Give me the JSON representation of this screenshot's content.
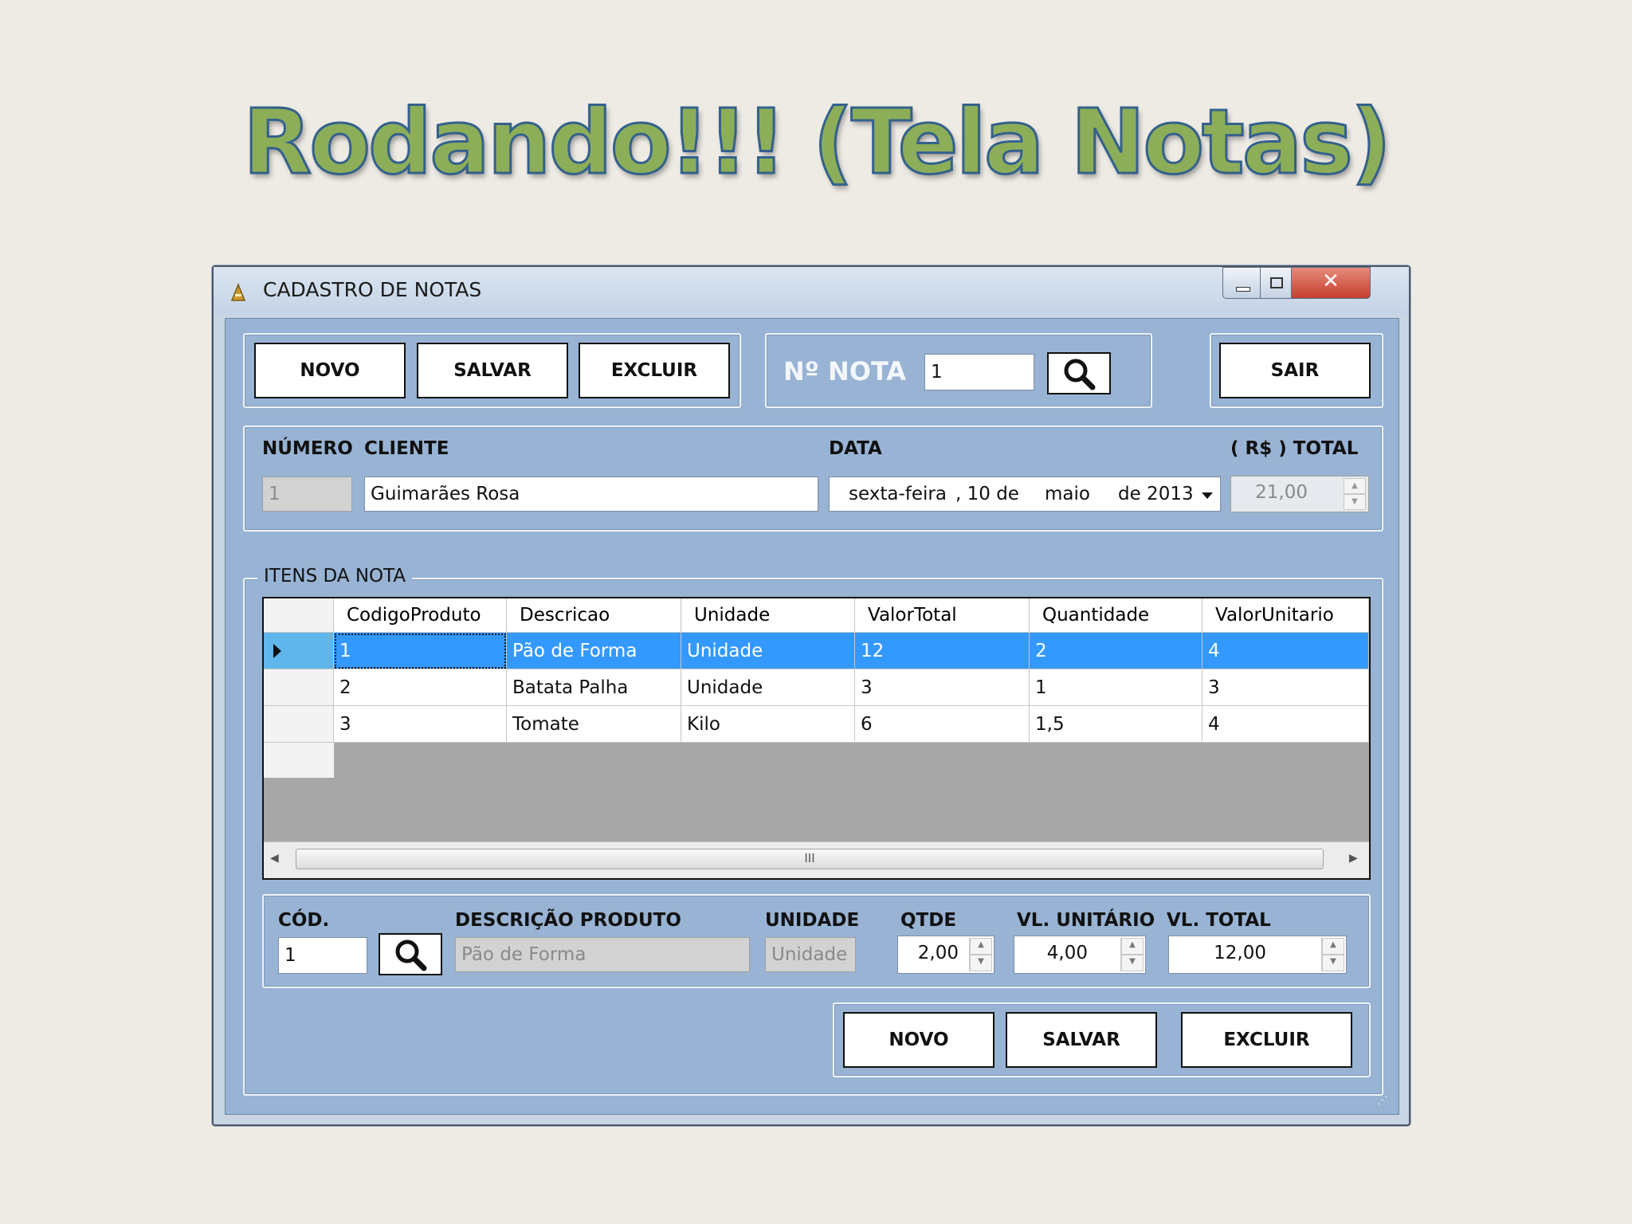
{
  "slide": {
    "title": "Rodando!!! (Tela Notas)"
  },
  "window": {
    "title": "CADASTRO DE NOTAS"
  },
  "top_buttons": {
    "novo": "NOVO",
    "salvar": "SALVAR",
    "excluir": "EXCLUIR",
    "sair": "SAIR"
  },
  "search": {
    "label": "Nº NOTA",
    "value": "1"
  },
  "header": {
    "numero_label": "NÚMERO",
    "numero_value": "1",
    "cliente_label": "CLIENTE",
    "cliente_value": "Guimarães Rosa",
    "data_label": "DATA",
    "date": {
      "weekday": "sexta-feira",
      "day": ", 10 de",
      "month": "maio",
      "year": "de 2013"
    },
    "total_label": "( R$ ) TOTAL",
    "total_value": "21,00"
  },
  "items": {
    "title": "ITENS DA NOTA",
    "columns": [
      "CodigoProduto",
      "Descricao",
      "Unidade",
      "ValorTotal",
      "Quantidade",
      "ValorUnitario"
    ],
    "rows": [
      [
        "1",
        "Pão de Forma",
        "Unidade",
        "12",
        "2",
        "4"
      ],
      [
        "2",
        "Batata Palha",
        "Unidade",
        "3",
        "1",
        "3"
      ],
      [
        "3",
        "Tomate",
        "Kilo",
        "6",
        "1,5",
        "4"
      ]
    ],
    "selected_row": 0,
    "hscroll_grip": "III"
  },
  "item_form": {
    "cod_label": "CÓD.",
    "cod_value": "1",
    "desc_label": "DESCRIÇÃO PRODUTO",
    "desc_value": "Pão de Forma",
    "unidade_label": "UNIDADE",
    "unidade_value": "Unidade",
    "qtde_label": "QTDE",
    "qtde_value": "2,00",
    "vl_unit_label": "VL. UNITÁRIO",
    "vl_unit_value": "4,00",
    "vl_total_label": "VL. TOTAL",
    "vl_total_value": "12,00"
  },
  "bottom_buttons": {
    "novo": "NOVO",
    "salvar": "SALVAR",
    "excluir": "EXCLUIR"
  },
  "colors": {
    "title_fill": "#8dae58",
    "title_outline": "#34618c",
    "client_bg": "#98b3d3",
    "selection": "#3399ff",
    "close_button": "#c94b3b"
  },
  "icons": [
    "app-icon",
    "minimize-icon",
    "maximize-icon",
    "close-icon",
    "search-icon",
    "dropdown-arrow-icon",
    "row-pointer-icon",
    "scroll-left-icon",
    "scroll-right-icon",
    "spin-up-icon",
    "spin-down-icon",
    "resize-grip-icon"
  ]
}
